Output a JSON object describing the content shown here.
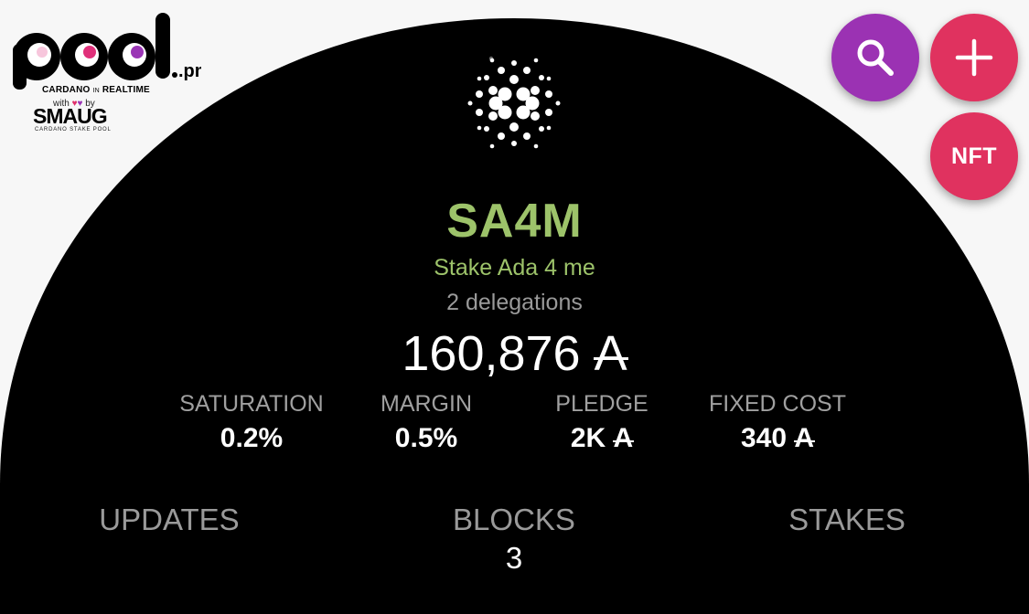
{
  "logo": {
    "wordmark": "pool.pm",
    "tagline_left": "CARDANO",
    "tagline_mid": "IN",
    "tagline_right": "REALTIME",
    "with_text": "with",
    "by_text": "by",
    "partner": "SMAUG",
    "partner_sub": "CARDANO STAKE POOL"
  },
  "actions": {
    "search_icon": "magnifier-icon",
    "add_icon": "plus-icon",
    "nft_label": "NFT"
  },
  "pool": {
    "ticker": "SA4M",
    "name": "Stake Ada 4 me",
    "delegations": "2 delegations",
    "live_stake": "160,876",
    "currency_symbol": "A"
  },
  "stats": [
    {
      "label": "SATURATION",
      "value": "0.2%"
    },
    {
      "label": "MARGIN",
      "value": "0.5%"
    },
    {
      "label": "PLEDGE",
      "value": "2K",
      "currency": "A"
    },
    {
      "label": "FIXED COST",
      "value": "340",
      "currency": "A"
    }
  ],
  "tabs": [
    {
      "label": "UPDATES",
      "count": ""
    },
    {
      "label": "BLOCKS",
      "count": "3"
    },
    {
      "label": "STAKES",
      "count": ""
    }
  ],
  "colors": {
    "background": "#f7f7f7",
    "dome": "#000000",
    "accent_green": "#9dc36a",
    "search_purple": "#9b32b3",
    "action_pink": "#e0325f",
    "muted_gray": "#9a9a9a"
  }
}
